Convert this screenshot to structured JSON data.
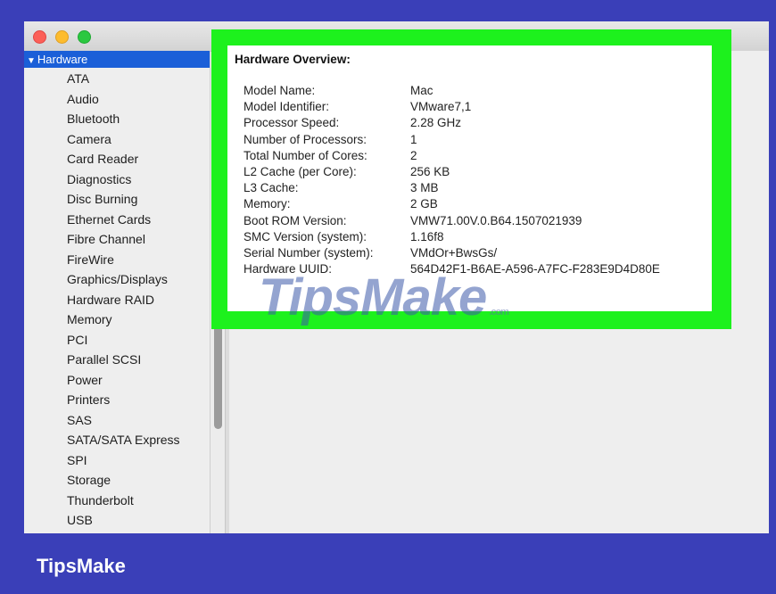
{
  "colors": {
    "background": "#3a3fb8",
    "sidebar_selection": "#1b5fd8",
    "highlight": "#1df11d",
    "traffic_red": "#fc5f57",
    "traffic_yellow": "#fdbc2e",
    "traffic_green": "#2bc840"
  },
  "window": {
    "traffic_lights": [
      "close-icon",
      "minimize-icon",
      "zoom-icon"
    ]
  },
  "sidebar": {
    "section": "Hardware",
    "items": [
      "ATA",
      "Audio",
      "Bluetooth",
      "Camera",
      "Card Reader",
      "Diagnostics",
      "Disc Burning",
      "Ethernet Cards",
      "Fibre Channel",
      "FireWire",
      "Graphics/Displays",
      "Hardware RAID",
      "Memory",
      "PCI",
      "Parallel SCSI",
      "Power",
      "Printers",
      "SAS",
      "SATA/SATA Express",
      "SPI",
      "Storage",
      "Thunderbolt",
      "USB"
    ]
  },
  "overview": {
    "title": "Hardware Overview:",
    "rows": [
      {
        "key": "Model Name:",
        "value": "Mac"
      },
      {
        "key": "Model Identifier:",
        "value": "VMware7,1"
      },
      {
        "key": "Processor Speed:",
        "value": "2.28 GHz"
      },
      {
        "key": "Number of Processors:",
        "value": "1"
      },
      {
        "key": "Total Number of Cores:",
        "value": "2"
      },
      {
        "key": "L2 Cache (per Core):",
        "value": "256 KB"
      },
      {
        "key": "L3 Cache:",
        "value": "3 MB"
      },
      {
        "key": "Memory:",
        "value": "2 GB"
      },
      {
        "key": "Boot ROM Version:",
        "value": "VMW71.00V.0.B64.1507021939"
      },
      {
        "key": "SMC Version (system):",
        "value": "1.16f8"
      },
      {
        "key": "Serial Number (system):",
        "value": "VMdOr+BwsGs/"
      },
      {
        "key": "Hardware UUID:",
        "value": "564D42F1-B6AE-A596-A7FC-F283E9D4D80E"
      }
    ]
  },
  "watermark": {
    "text": "TipsMake",
    "suffix": ".com"
  },
  "brand": "TipsMake"
}
